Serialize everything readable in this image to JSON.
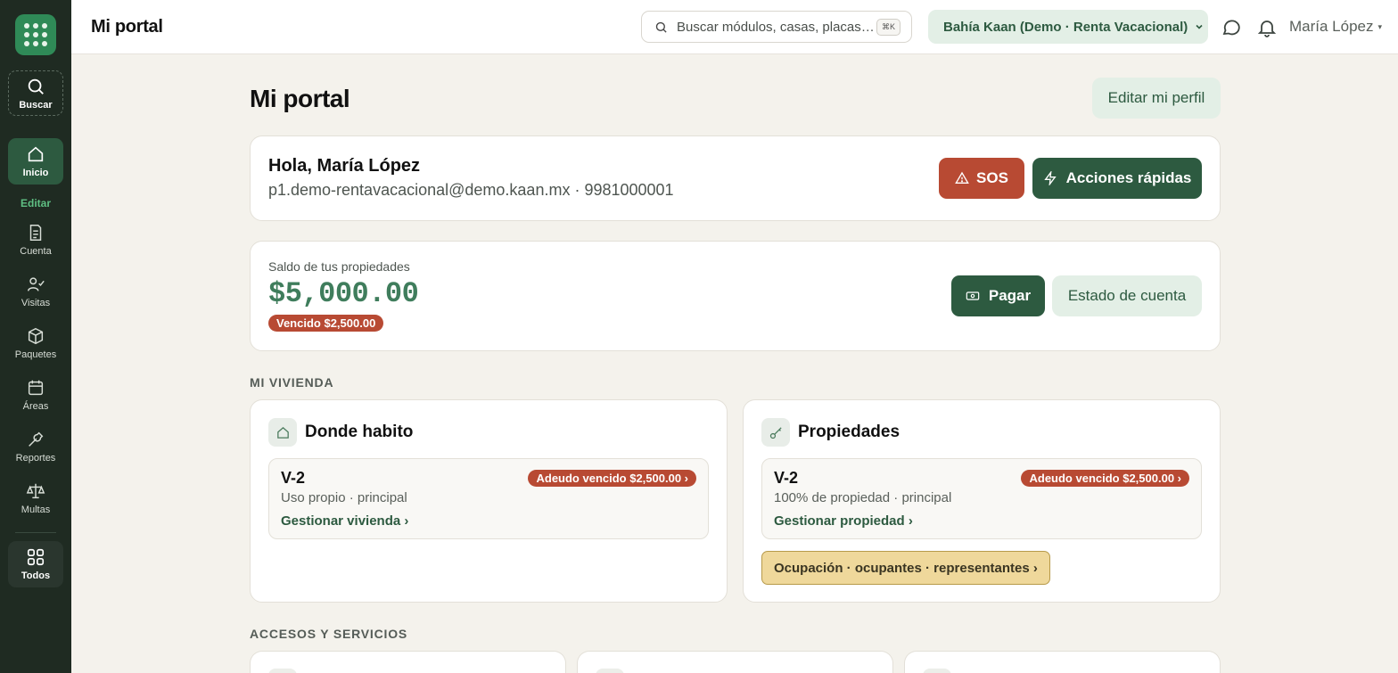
{
  "sidebar": {
    "search_label": "Buscar",
    "edit_label": "Editar",
    "items": [
      {
        "label": "Inicio",
        "icon": "home-icon",
        "active": true
      },
      {
        "label": "Cuenta",
        "icon": "document-icon"
      },
      {
        "label": "Visitas",
        "icon": "visitor-check-icon"
      },
      {
        "label": "Paquetes",
        "icon": "package-icon"
      },
      {
        "label": "Áreas",
        "icon": "calendar-icon"
      },
      {
        "label": "Reportes",
        "icon": "wrench-icon"
      },
      {
        "label": "Multas",
        "icon": "scale-icon"
      }
    ],
    "all_label": "Todos"
  },
  "topbar": {
    "title": "Mi portal",
    "search_placeholder": "Buscar módulos, casas, placas…",
    "search_shortcut": "⌘K",
    "org_selector": "Bahía Kaan (Demo · Renta Vacacional)",
    "user_name": "María López"
  },
  "page": {
    "title": "Mi portal",
    "edit_profile": "Editar mi perfil"
  },
  "greeting": {
    "hello": "Hola, María López",
    "contact": "p1.demo-rentavacacional@demo.kaan.mx · 9981000001",
    "sos_label": "SOS",
    "quick_actions_label": "Acciones rápidas"
  },
  "balance": {
    "label": "Saldo de tus propiedades",
    "amount": "$5,000.00",
    "overdue_badge": "Vencido $2,500.00",
    "pay_label": "Pagar",
    "statement_label": "Estado de cuenta"
  },
  "housing": {
    "section_label": "MI VIVIENDA",
    "residence": {
      "title": "Donde habito",
      "unit_code": "V-2",
      "unit_meta": "Uso propio · principal",
      "unit_badge": "Adeudo vencido $2,500.00 ›",
      "unit_link": "Gestionar vivienda ›"
    },
    "properties": {
      "title": "Propiedades",
      "unit_code": "V-2",
      "unit_meta": "100% de propiedad · principal",
      "unit_badge": "Adeudo vencido $2,500.00 ›",
      "unit_link": "Gestionar propiedad ›",
      "occupancy_button": "Ocupación · ocupantes · representantes ›"
    }
  },
  "services": {
    "section_label": "ACCESOS Y SERVICIOS"
  },
  "colors": {
    "sidebar_bg": "#1f2b22",
    "brand_green": "#2d5a40",
    "accent_green": "#2f8a57",
    "danger": "#b84a33",
    "warning_bg": "#efd89b"
  }
}
